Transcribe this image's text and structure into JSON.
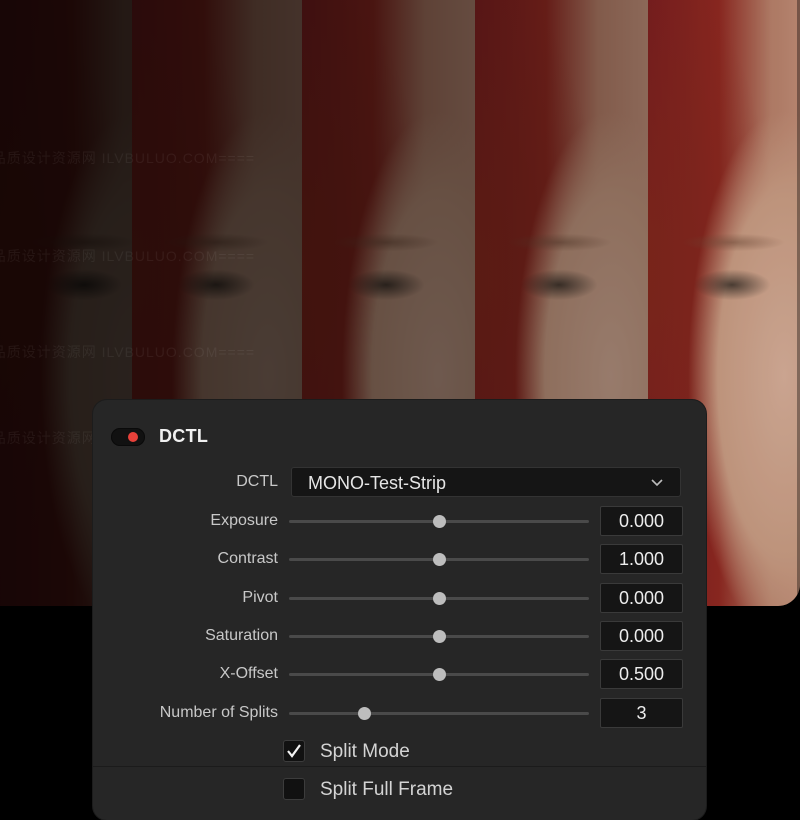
{
  "watermark": "====高品质设计资源网 ILVBULUO.COM====",
  "panel": {
    "title": "DCTL",
    "enabled": true,
    "accent_color": "#e8413a",
    "dctl": {
      "label": "DCTL",
      "value": "MONO-Test-Strip"
    },
    "params": [
      {
        "key": "exposure",
        "label": "Exposure",
        "value": "0.000",
        "slider": 0.5
      },
      {
        "key": "contrast",
        "label": "Contrast",
        "value": "1.000",
        "slider": 0.5
      },
      {
        "key": "pivot",
        "label": "Pivot",
        "value": "0.000",
        "slider": 0.5
      },
      {
        "key": "saturation",
        "label": "Saturation",
        "value": "0.000",
        "slider": 0.5
      },
      {
        "key": "x-offset",
        "label": "X-Offset",
        "value": "0.500",
        "slider": 0.5
      },
      {
        "key": "splits",
        "label": "Number of Splits",
        "value": "3",
        "slider": 0.25
      }
    ],
    "checkboxes": [
      {
        "key": "split-mode",
        "label": "Split Mode",
        "checked": true
      },
      {
        "key": "split-full-frame",
        "label": "Split Full Frame",
        "checked": false
      }
    ]
  },
  "photo_strip": {
    "splits": 5,
    "shade_levels": [
      0.82,
      0.68,
      0.52,
      0.34,
      0.12
    ]
  }
}
